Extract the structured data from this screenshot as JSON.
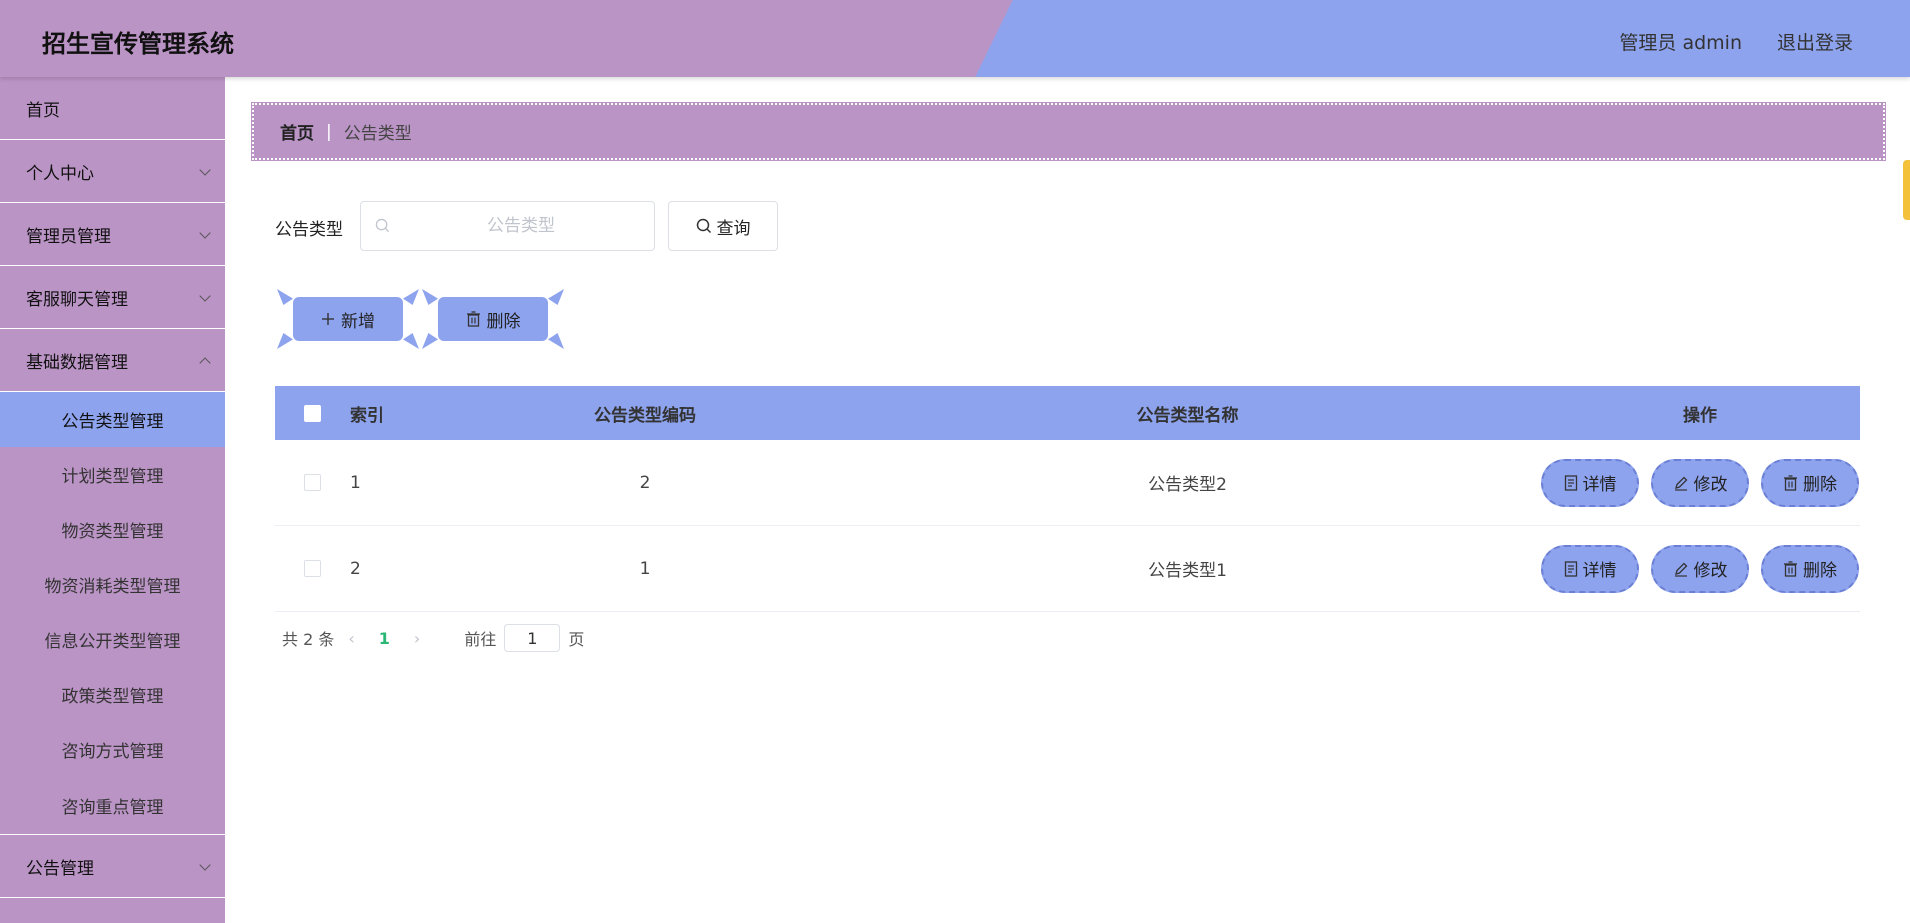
{
  "header": {
    "title": "招生宣传管理系统",
    "admin_label": "管理员 admin",
    "logout_label": "退出登录"
  },
  "sidebar": {
    "items": [
      {
        "label": "首页"
      },
      {
        "label": "个人中心"
      },
      {
        "label": "管理员管理"
      },
      {
        "label": "客服聊天管理"
      },
      {
        "label": "基础数据管理"
      },
      {
        "label": "公告管理"
      }
    ],
    "sub_items": [
      {
        "label": "公告类型管理"
      },
      {
        "label": "计划类型管理"
      },
      {
        "label": "物资类型管理"
      },
      {
        "label": "物资消耗类型管理"
      },
      {
        "label": "信息公开类型管理"
      },
      {
        "label": "政策类型管理"
      },
      {
        "label": "咨询方式管理"
      },
      {
        "label": "咨询重点管理"
      }
    ]
  },
  "breadcrumb": {
    "home": "首页",
    "separator": "|",
    "current": "公告类型"
  },
  "search": {
    "label": "公告类型",
    "placeholder": "公告类型",
    "value": "",
    "query_label": "查询"
  },
  "toolbar": {
    "add_label": "新增",
    "delete_label": "删除"
  },
  "table": {
    "headers": [
      "索引",
      "公告类型编码",
      "公告类型名称",
      "操作"
    ],
    "rows": [
      {
        "index": "1",
        "code": "2",
        "name": "公告类型2"
      },
      {
        "index": "2",
        "code": "1",
        "name": "公告类型1"
      }
    ],
    "ops": {
      "detail": "详情",
      "edit": "修改",
      "delete": "删除"
    }
  },
  "pager": {
    "total": "共 2 条",
    "current_page": "1",
    "goto_label": "前往",
    "goto_value": "1",
    "page_suffix": "页"
  },
  "colors": {
    "purple": "#bb94c6",
    "blue": "#8ea3ee"
  }
}
